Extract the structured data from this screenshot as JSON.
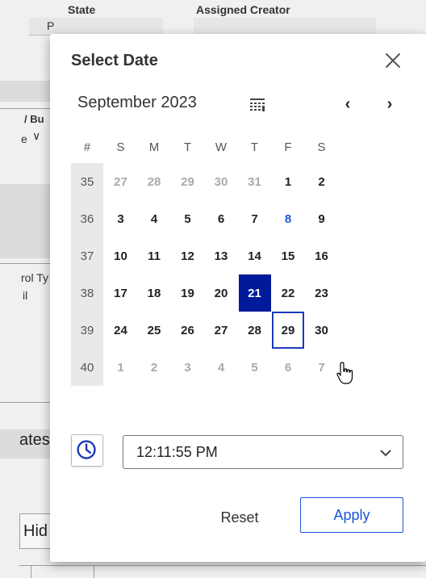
{
  "background": {
    "state_label": "State",
    "state_value": "P",
    "creator_label": "Assigned Creator",
    "frag_bu": "/ Bu",
    "frag_e": "e",
    "frag_rol": "rol Ty",
    "frag_l": "il",
    "frag_ates": "ates",
    "frag_hid": "Hid"
  },
  "dialog": {
    "title": "Select Date",
    "close_icon": "close-icon",
    "month_label": "September 2023",
    "calendar_icon": "calendar-grid-icon",
    "prev_label": "‹",
    "next_label": "›",
    "week_header": "#",
    "weekday_headers": [
      "S",
      "M",
      "T",
      "W",
      "T",
      "F",
      "S"
    ],
    "weeks": [
      {
        "num": "35",
        "days": [
          {
            "d": "27",
            "muted": true
          },
          {
            "d": "28",
            "muted": true
          },
          {
            "d": "29",
            "muted": true
          },
          {
            "d": "30",
            "muted": true
          },
          {
            "d": "31",
            "muted": true
          },
          {
            "d": "1"
          },
          {
            "d": "2"
          }
        ]
      },
      {
        "num": "36",
        "days": [
          {
            "d": "3"
          },
          {
            "d": "4"
          },
          {
            "d": "5"
          },
          {
            "d": "6"
          },
          {
            "d": "7"
          },
          {
            "d": "8",
            "today": true
          },
          {
            "d": "9"
          }
        ]
      },
      {
        "num": "37",
        "days": [
          {
            "d": "10"
          },
          {
            "d": "11"
          },
          {
            "d": "12"
          },
          {
            "d": "13"
          },
          {
            "d": "14"
          },
          {
            "d": "15"
          },
          {
            "d": "16"
          }
        ]
      },
      {
        "num": "38",
        "days": [
          {
            "d": "17"
          },
          {
            "d": "18"
          },
          {
            "d": "19"
          },
          {
            "d": "20"
          },
          {
            "d": "21",
            "selected": true
          },
          {
            "d": "22"
          },
          {
            "d": "23"
          }
        ]
      },
      {
        "num": "39",
        "days": [
          {
            "d": "24"
          },
          {
            "d": "25"
          },
          {
            "d": "26"
          },
          {
            "d": "27"
          },
          {
            "d": "28"
          },
          {
            "d": "29",
            "hover": true
          },
          {
            "d": "30"
          }
        ]
      },
      {
        "num": "40",
        "days": [
          {
            "d": "1",
            "muted": true
          },
          {
            "d": "2",
            "muted": true
          },
          {
            "d": "3",
            "muted": true
          },
          {
            "d": "4",
            "muted": true
          },
          {
            "d": "5",
            "muted": true
          },
          {
            "d": "6",
            "muted": true
          },
          {
            "d": "7",
            "muted": true
          }
        ]
      }
    ],
    "time_icon": "clock-icon",
    "time_value": "12:11:55 PM",
    "reset_label": "Reset",
    "apply_label": "Apply"
  },
  "colors": {
    "selected_bg": "#001a99",
    "today_text": "#1a56db",
    "accent": "#1a56db"
  }
}
